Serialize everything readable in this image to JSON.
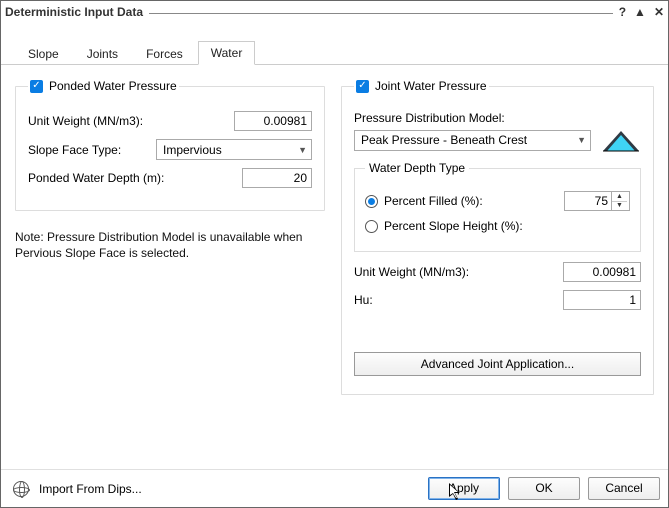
{
  "title": "Deterministic Input Data",
  "controls": {
    "help": "?",
    "minimize": "▲",
    "close": "✕"
  },
  "tabs": [
    "Slope",
    "Joints",
    "Forces",
    "Water"
  ],
  "active_tab": 3,
  "left": {
    "group_title": "Ponded Water Pressure",
    "unit_weight_label": "Unit Weight (MN/m3):",
    "unit_weight_value": "0.00981",
    "slope_face_label": "Slope Face Type:",
    "slope_face_value": "Impervious",
    "depth_label": "Ponded Water Depth (m):",
    "depth_value": "20"
  },
  "note": "Note: Pressure Distribution Model is unavailable when Pervious Slope Face is selected.",
  "right": {
    "group_title": "Joint Water Pressure",
    "pdm_label": "Pressure Distribution Model:",
    "pdm_value": "Peak Pressure - Beneath Crest",
    "wdt_title": "Water Depth Type",
    "pf_label": "Percent Filled (%):",
    "pf_value": "75",
    "psh_label": "Percent Slope Height (%):",
    "unit_weight_label": "Unit Weight (MN/m3):",
    "unit_weight_value": "0.00981",
    "hu_label": "Hu:",
    "hu_value": "1",
    "advanced_label": "Advanced Joint Application..."
  },
  "footer": {
    "import_label": "Import From Dips...",
    "apply": "Apply",
    "ok": "OK",
    "cancel": "Cancel"
  }
}
